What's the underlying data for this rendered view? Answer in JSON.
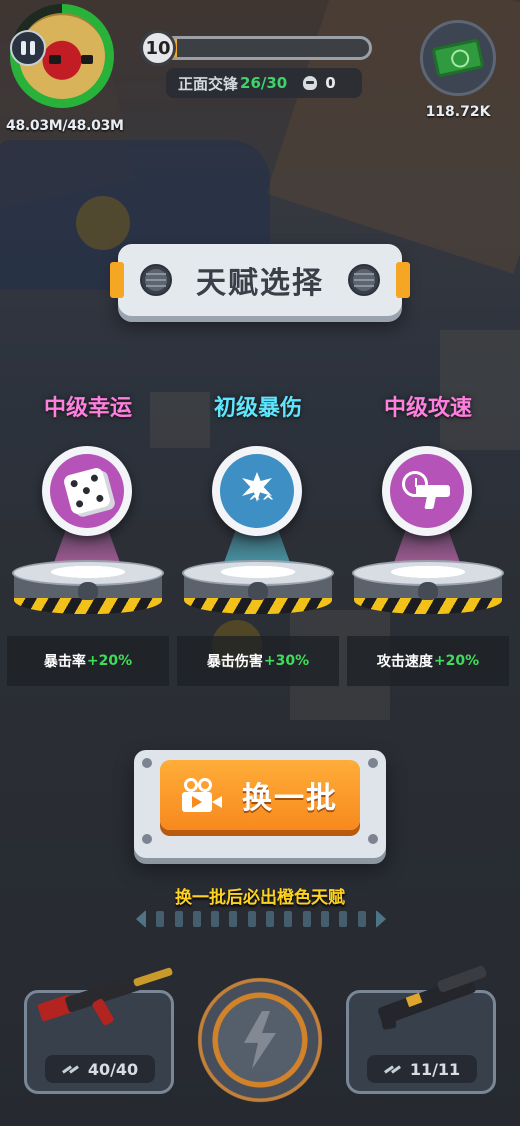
{
  "hud": {
    "boss_hp": "48.03M/48.03M",
    "boss_hp_fraction": 0.78,
    "level": "10",
    "level_progress": 0.06,
    "wave_label": "正面交锋",
    "wave_count": "26/30",
    "kills": "0",
    "money": "118.72K"
  },
  "title": "天赋选择",
  "talents": [
    {
      "name": "中级幸运",
      "name_color": "#ff7fe0",
      "icon": "dice-icon",
      "icon_bg": "#b553b8",
      "stat": "暴击率",
      "value": "+20%"
    },
    {
      "name": "初级暴伤",
      "name_color": "#5ee6ff",
      "icon": "crit-damage-icon",
      "icon_bg": "#3d8fc4",
      "stat": "暴击伤害",
      "value": "+30%"
    },
    {
      "name": "中级攻速",
      "name_color": "#ff7fe0",
      "icon": "attack-speed-icon",
      "icon_bg": "#b553b8",
      "stat": "攻击速度",
      "value": "+20%"
    }
  ],
  "refresh": {
    "label": "换一批",
    "hint": "换一批后必出橙色天赋"
  },
  "weapons": {
    "left_ammo": "40/40",
    "right_ammo": "11/11"
  }
}
